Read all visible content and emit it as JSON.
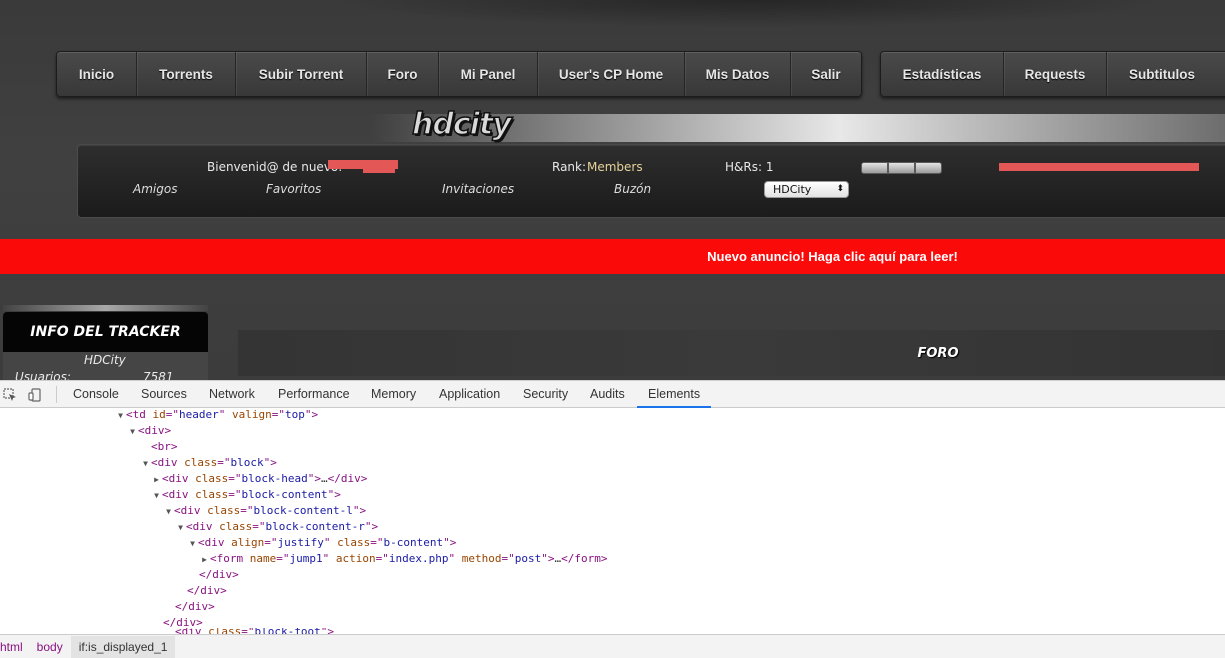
{
  "nav_left": [
    "Inicio",
    "Torrents",
    "Subir Torrent",
    "Foro",
    "Mi Panel",
    "User's CP Home",
    "Mis Datos",
    "Salir"
  ],
  "nav_right": [
    "Estadísticas",
    "Requests",
    "Subtitulos"
  ],
  "logo": "hdcity",
  "user_panel": {
    "welcome": "Bienvenid@ de nuevo:",
    "rank_label": "Rank:",
    "rank_value": "Members",
    "hrs": "H&Rs: 1",
    "links": [
      "Amigos",
      "Favoritos",
      "Invitaciones",
      "Buzón"
    ],
    "select_value": "HDCity"
  },
  "announcement": "Nuevo anuncio! Haga clic aquí para leer!",
  "sidebar": {
    "title": "INFO DEL TRACKER",
    "site_name": "HDCity",
    "users_label": "Usuarios:",
    "users_value": "7581"
  },
  "forum_title": "FORO",
  "devtools": {
    "tabs": [
      "Console",
      "Sources",
      "Network",
      "Performance",
      "Memory",
      "Application",
      "Security",
      "Audits",
      "Elements"
    ],
    "active_tab": "Elements",
    "breadcrumbs": [
      "html",
      "body",
      "if:is_displayed_1"
    ]
  },
  "colors": {
    "announcement_bg": "#fb0a0a",
    "rank_color": "#e6d39a",
    "tag_color": "#881280",
    "attr_name_color": "#994500",
    "attr_value_color": "#1a1aa6",
    "active_tab_underline": "#1a73e8"
  }
}
